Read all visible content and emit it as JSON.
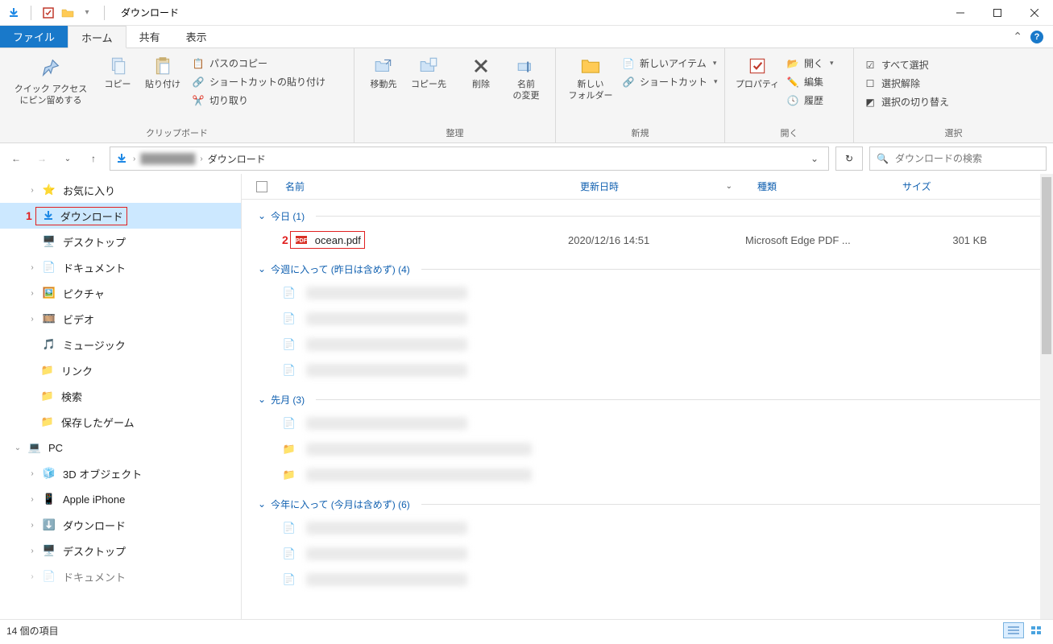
{
  "titlebar": {
    "title": "ダウンロード"
  },
  "tabs": {
    "file": "ファイル",
    "home": "ホーム",
    "share": "共有",
    "view": "表示"
  },
  "ribbon": {
    "clipboard": {
      "label": "クリップボード",
      "pin": "クイック アクセス\nにピン留めする",
      "copy": "コピー",
      "paste": "貼り付け",
      "pathcopy": "パスのコピー",
      "shortcut": "ショートカットの貼り付け",
      "cut": "切り取り"
    },
    "organize": {
      "label": "整理",
      "moveto": "移動先",
      "copyto": "コピー先",
      "delete": "削除",
      "rename": "名前\nの変更"
    },
    "new": {
      "label": "新規",
      "newfolder": "新しい\nフォルダー",
      "newitem": "新しいアイテム",
      "shortcut": "ショートカット"
    },
    "open": {
      "label": "開く",
      "properties": "プロパティ",
      "open": "開く",
      "edit": "編集",
      "history": "履歴"
    },
    "select": {
      "label": "選択",
      "all": "すべて選択",
      "none": "選択解除",
      "invert": "選択の切り替え"
    }
  },
  "address": {
    "current": "ダウンロード"
  },
  "search": {
    "placeholder": "ダウンロードの検索"
  },
  "columns": {
    "name": "名前",
    "date": "更新日時",
    "type": "種類",
    "size": "サイズ"
  },
  "tree": {
    "favorites": "お気に入り",
    "downloads": "ダウンロード",
    "desktop": "デスクトップ",
    "documents": "ドキュメント",
    "pictures": "ピクチャ",
    "videos": "ビデオ",
    "music": "ミュージック",
    "links": "リンク",
    "searches": "検索",
    "savedgames": "保存したゲーム",
    "pc": "PC",
    "objects3d": "3D オブジェクト",
    "iphone": "Apple iPhone",
    "downloads2": "ダウンロード",
    "desktop2": "デスクトップ",
    "documents2": "ドキュメント"
  },
  "groups": {
    "today": "今日 (1)",
    "thisweek": "今週に入って (昨日は含めず) (4)",
    "lastmonth": "先月 (3)",
    "thisyear": "今年に入って (今月は含めず) (6)"
  },
  "files": {
    "ocean": {
      "name": "ocean.pdf",
      "date": "2020/12/16 14:51",
      "type": "Microsoft Edge PDF ...",
      "size": "301 KB"
    }
  },
  "status": {
    "count": "14 個の項目"
  },
  "annotations": {
    "one": "1",
    "two": "2"
  }
}
